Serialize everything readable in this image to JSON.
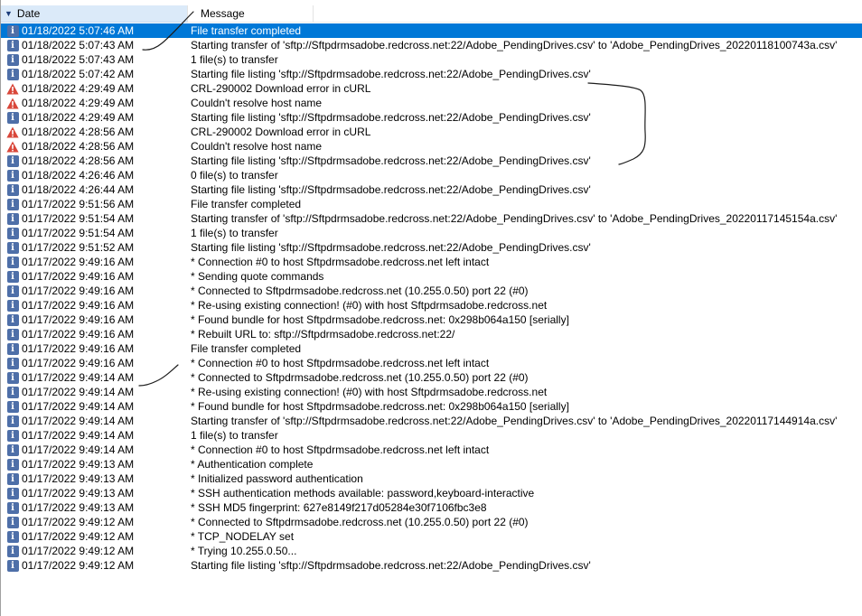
{
  "columns": {
    "date": "Date",
    "message": "Message"
  },
  "rows": [
    {
      "type": "info",
      "date": "01/18/2022 5:07:46 AM",
      "message": "File transfer completed",
      "selected": true
    },
    {
      "type": "info",
      "date": "01/18/2022 5:07:43 AM",
      "message": "Starting transfer of 'sftp://Sftpdrmsadobe.redcross.net:22/Adobe_PendingDrives.csv' to 'Adobe_PendingDrives_20220118100743a.csv'"
    },
    {
      "type": "info",
      "date": "01/18/2022 5:07:43 AM",
      "message": "1 file(s) to transfer"
    },
    {
      "type": "info",
      "date": "01/18/2022 5:07:42 AM",
      "message": "Starting file listing 'sftp://Sftpdrmsadobe.redcross.net:22/Adobe_PendingDrives.csv'"
    },
    {
      "type": "warning",
      "date": "01/18/2022 4:29:49 AM",
      "message": "CRL-290002 Download error in cURL"
    },
    {
      "type": "warning",
      "date": "01/18/2022 4:29:49 AM",
      "message": "Couldn't resolve host name"
    },
    {
      "type": "info",
      "date": "01/18/2022 4:29:49 AM",
      "message": "Starting file listing 'sftp://Sftpdrmsadobe.redcross.net:22/Adobe_PendingDrives.csv'"
    },
    {
      "type": "warning",
      "date": "01/18/2022 4:28:56 AM",
      "message": "CRL-290002 Download error in cURL"
    },
    {
      "type": "warning",
      "date": "01/18/2022 4:28:56 AM",
      "message": "Couldn't resolve host name"
    },
    {
      "type": "info",
      "date": "01/18/2022 4:28:56 AM",
      "message": "Starting file listing 'sftp://Sftpdrmsadobe.redcross.net:22/Adobe_PendingDrives.csv'"
    },
    {
      "type": "info",
      "date": "01/18/2022 4:26:46 AM",
      "message": "0 file(s) to transfer"
    },
    {
      "type": "info",
      "date": "01/18/2022 4:26:44 AM",
      "message": "Starting file listing 'sftp://Sftpdrmsadobe.redcross.net:22/Adobe_PendingDrives.csv'"
    },
    {
      "type": "info",
      "date": "01/17/2022 9:51:56 AM",
      "message": "File transfer completed"
    },
    {
      "type": "info",
      "date": "01/17/2022 9:51:54 AM",
      "message": "Starting transfer of 'sftp://Sftpdrmsadobe.redcross.net:22/Adobe_PendingDrives.csv' to 'Adobe_PendingDrives_20220117145154a.csv'"
    },
    {
      "type": "info",
      "date": "01/17/2022 9:51:54 AM",
      "message": "1 file(s) to transfer"
    },
    {
      "type": "info",
      "date": "01/17/2022 9:51:52 AM",
      "message": "Starting file listing 'sftp://Sftpdrmsadobe.redcross.net:22/Adobe_PendingDrives.csv'"
    },
    {
      "type": "info",
      "date": "01/17/2022 9:49:16 AM",
      "message": "* Connection #0 to host Sftpdrmsadobe.redcross.net left intact"
    },
    {
      "type": "info",
      "date": "01/17/2022 9:49:16 AM",
      "message": "* Sending quote commands"
    },
    {
      "type": "info",
      "date": "01/17/2022 9:49:16 AM",
      "message": "* Connected to Sftpdrmsadobe.redcross.net (10.255.0.50) port 22 (#0)"
    },
    {
      "type": "info",
      "date": "01/17/2022 9:49:16 AM",
      "message": "* Re-using existing connection! (#0) with host Sftpdrmsadobe.redcross.net"
    },
    {
      "type": "info",
      "date": "01/17/2022 9:49:16 AM",
      "message": "* Found bundle for host Sftpdrmsadobe.redcross.net: 0x298b064a150 [serially]"
    },
    {
      "type": "info",
      "date": "01/17/2022 9:49:16 AM",
      "message": "* Rebuilt URL to: sftp://Sftpdrmsadobe.redcross.net:22/"
    },
    {
      "type": "info",
      "date": "01/17/2022 9:49:16 AM",
      "message": "File transfer completed"
    },
    {
      "type": "info",
      "date": "01/17/2022 9:49:16 AM",
      "message": "* Connection #0 to host Sftpdrmsadobe.redcross.net left intact"
    },
    {
      "type": "info",
      "date": "01/17/2022 9:49:14 AM",
      "message": "* Connected to Sftpdrmsadobe.redcross.net (10.255.0.50) port 22 (#0)"
    },
    {
      "type": "info",
      "date": "01/17/2022 9:49:14 AM",
      "message": "* Re-using existing connection! (#0) with host Sftpdrmsadobe.redcross.net"
    },
    {
      "type": "info",
      "date": "01/17/2022 9:49:14 AM",
      "message": "* Found bundle for host Sftpdrmsadobe.redcross.net: 0x298b064a150 [serially]"
    },
    {
      "type": "info",
      "date": "01/17/2022 9:49:14 AM",
      "message": "Starting transfer of 'sftp://Sftpdrmsadobe.redcross.net:22/Adobe_PendingDrives.csv' to 'Adobe_PendingDrives_20220117144914a.csv'"
    },
    {
      "type": "info",
      "date": "01/17/2022 9:49:14 AM",
      "message": "1 file(s) to transfer"
    },
    {
      "type": "info",
      "date": "01/17/2022 9:49:14 AM",
      "message": "* Connection #0 to host Sftpdrmsadobe.redcross.net left intact"
    },
    {
      "type": "info",
      "date": "01/17/2022 9:49:13 AM",
      "message": "* Authentication complete"
    },
    {
      "type": "info",
      "date": "01/17/2022 9:49:13 AM",
      "message": "* Initialized password authentication"
    },
    {
      "type": "info",
      "date": "01/17/2022 9:49:13 AM",
      "message": "* SSH authentication methods available: password,keyboard-interactive"
    },
    {
      "type": "info",
      "date": "01/17/2022 9:49:13 AM",
      "message": "* SSH MD5 fingerprint: 627e8149f217d05284e30f7106fbc3e8"
    },
    {
      "type": "info",
      "date": "01/17/2022 9:49:12 AM",
      "message": "* Connected to Sftpdrmsadobe.redcross.net (10.255.0.50) port 22 (#0)"
    },
    {
      "type": "info",
      "date": "01/17/2022 9:49:12 AM",
      "message": "* TCP_NODELAY set"
    },
    {
      "type": "info",
      "date": "01/17/2022 9:49:12 AM",
      "message": "*   Trying 10.255.0.50..."
    },
    {
      "type": "info",
      "date": "01/17/2022 9:49:12 AM",
      "message": "Starting file listing 'sftp://Sftpdrmsadobe.redcross.net:22/Adobe_PendingDrives.csv'"
    }
  ],
  "colors": {
    "selection": "#0078d7",
    "info_icon": "#4e6fa8",
    "warning_icon": "#d9473a",
    "sort_header": "#dbeaf9"
  },
  "icons": {
    "info": "info-icon",
    "warning": "warning-icon",
    "sort": "sort-descending-icon"
  }
}
